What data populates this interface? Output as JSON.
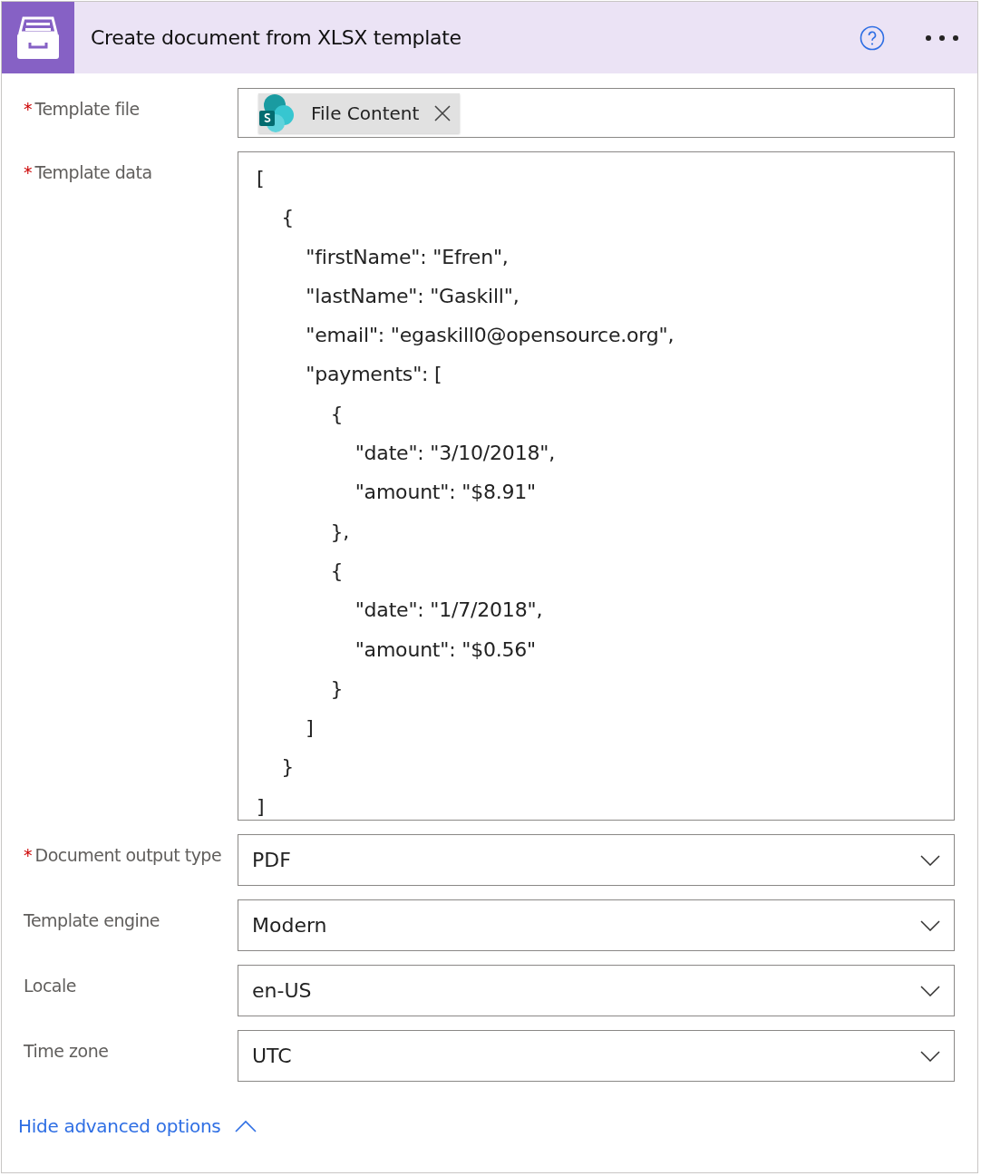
{
  "header": {
    "title": "Create document from XLSX template"
  },
  "fields": [
    {
      "kind": "token",
      "label": "Template file",
      "required_mark": "*",
      "token": "File Content"
    },
    {
      "kind": "code",
      "label": "Template data",
      "required_mark": "*",
      "value": "[\n    {\n        \"firstName\": \"Efren\",\n        \"lastName\": \"Gaskill\",\n        \"email\": \"egaskill0@opensource.org\",\n        \"payments\": [\n            {\n                \"date\": \"3/10/2018\",\n                \"amount\": \"$8.91\"\n            },\n            {\n                \"date\": \"1/7/2018\",\n                \"amount\": \"$0.56\"\n            }\n        ]\n    }\n]"
    },
    {
      "kind": "dropdown",
      "label": "Document output type",
      "required_mark": "*",
      "value": "PDF"
    },
    {
      "kind": "dropdown",
      "label": "Template engine",
      "value": "Modern"
    },
    {
      "kind": "dropdown",
      "label": "Locale",
      "value": "en-US"
    },
    {
      "kind": "dropdown",
      "label": "Time zone",
      "value": "UTC"
    }
  ],
  "advanced_toggle": {
    "label": "Hide advanced options",
    "expanded": true
  }
}
